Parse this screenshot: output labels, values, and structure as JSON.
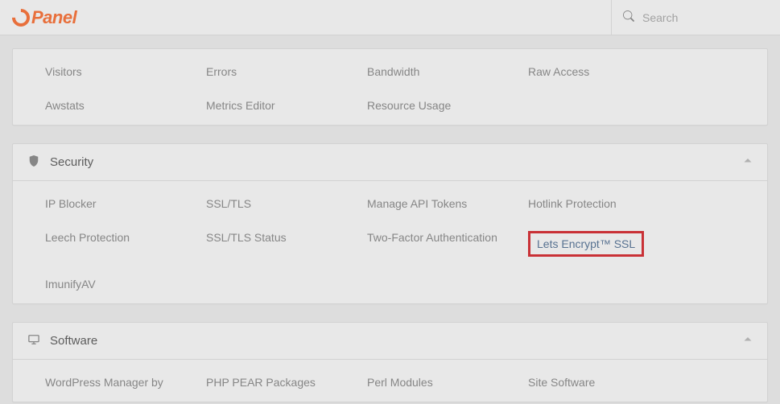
{
  "brand": "Panel",
  "search": {
    "placeholder": "Search"
  },
  "sections": {
    "metrics": {
      "items": [
        "Visitors",
        "Bandwidth",
        "Raw Access",
        "Awstats",
        "Metrics Editor",
        "Resource Usage",
        "Errors"
      ]
    },
    "security": {
      "title": "Security",
      "items": {
        "ip_blocker": "IP Blocker",
        "ssl_tls": "SSL/TLS",
        "manage_api": "Manage API Tokens",
        "hotlink": "Hotlink Protection",
        "leech": "Leech Protection",
        "ssl_status": "SSL/TLS Status",
        "two_factor": "Two-Factor Authentication",
        "lets_encrypt": "Lets Encrypt™ SSL",
        "imunify": "ImunifyAV"
      }
    },
    "software": {
      "title": "Software",
      "items": {
        "wordpress": "WordPress Manager by",
        "php_pear": "PHP PEAR Packages",
        "perl": "Perl Modules",
        "site_software": "Site Software"
      }
    }
  },
  "highlight": "lets_encrypt",
  "colors": {
    "accent": "#ff6c2c",
    "highlight_border": "#d92027",
    "link": "#4f6f95"
  }
}
